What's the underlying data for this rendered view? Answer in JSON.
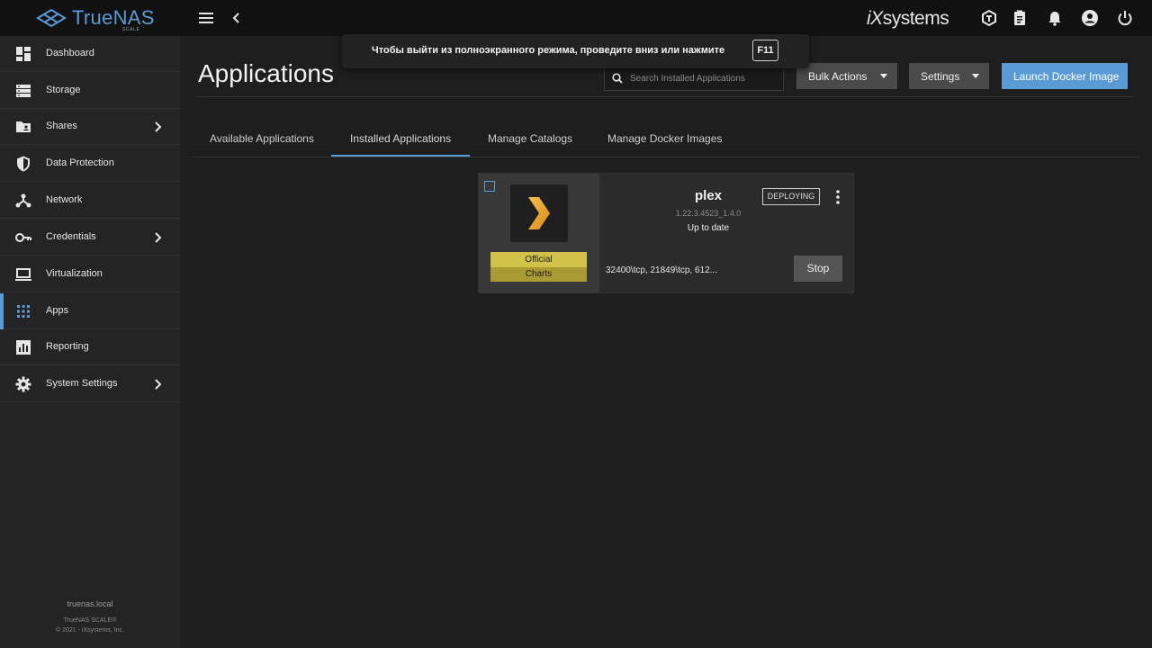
{
  "brand": {
    "name": "TrueNAS",
    "edition": "SCALE",
    "vendor_prefix": "iX",
    "vendor_suffix": "systems"
  },
  "colors": {
    "accent": "#5b9bd5",
    "topbar": "#111111",
    "sidebar": "#242424",
    "background": "#1e1e1e",
    "badge_official": "#d3c24a",
    "badge_charts": "#a99a33"
  },
  "header_icons": [
    "truecommand-icon",
    "clipboard-icon",
    "bell-icon",
    "account-circle-icon",
    "power-icon"
  ],
  "sidebar": {
    "items": [
      {
        "label": "Dashboard",
        "icon": "dashboard-icon"
      },
      {
        "label": "Storage",
        "icon": "storage-icon"
      },
      {
        "label": "Shares",
        "icon": "folder-shared-icon",
        "has_submenu": true
      },
      {
        "label": "Data Protection",
        "icon": "shield-icon"
      },
      {
        "label": "Network",
        "icon": "network-icon"
      },
      {
        "label": "Credentials",
        "icon": "key-icon",
        "has_submenu": true
      },
      {
        "label": "Virtualization",
        "icon": "laptop-icon"
      },
      {
        "label": "Apps",
        "icon": "apps-grid-icon",
        "active": true
      },
      {
        "label": "Reporting",
        "icon": "bar-chart-icon"
      },
      {
        "label": "System Settings",
        "icon": "gear-icon",
        "has_submenu": true
      }
    ],
    "hostname": "truenas.local",
    "product": "TrueNAS SCALE®",
    "copyright": "© 2021 - iXsystems, Inc."
  },
  "toast": {
    "text": "Чтобы выйти из полноэкранного режима, проведите вниз или нажмите",
    "key": "F11"
  },
  "page": {
    "title": "Applications",
    "search_placeholder": "Search Installed Applications",
    "bulk_actions_label": "Bulk Actions",
    "settings_label": "Settings",
    "launch_label": "Launch Docker Image",
    "tabs": [
      {
        "label": "Available Applications"
      },
      {
        "label": "Installed Applications",
        "active": true
      },
      {
        "label": "Manage Catalogs"
      },
      {
        "label": "Manage Docker Images"
      }
    ]
  },
  "app_card": {
    "name": "plex",
    "version": "1.22.3.4523_1.4.0",
    "update_status": "Up to date",
    "status": "DEPLOYING",
    "badge_line1": "Official",
    "badge_line2": "Charts",
    "ports": "32400\\tcp, 21849\\tcp, 612...",
    "stop_label": "Stop",
    "selected": false
  }
}
